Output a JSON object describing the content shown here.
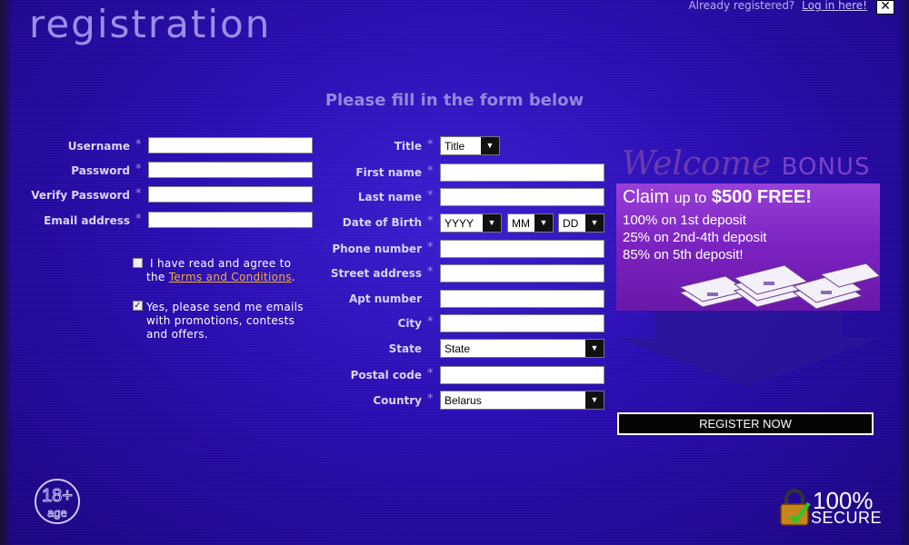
{
  "header": {
    "title": "registration",
    "already_text": "Already registered?",
    "login_link": "Log in here!",
    "close_label": "✕"
  },
  "subtitle": "Please fill in the form below",
  "left_form": {
    "username_label": "Username",
    "password_label": "Password",
    "verify_label": "Verify Password",
    "email_label": "Email address",
    "required_mark": "*"
  },
  "checkboxes": {
    "terms_text_1": "I have read and agree to",
    "terms_text_2": "the",
    "terms_link": "Terms and Conditions",
    "terms_dot": ".",
    "terms_checked": false,
    "promo_text": "Yes, please send me emails with promotions, contests and offers.",
    "promo_checked": true
  },
  "right_form": {
    "title_label": "Title",
    "title_value": "Title",
    "first_name_label": "First name",
    "last_name_label": "Last name",
    "dob_label": "Date of Birth",
    "dob_year": "YYYY",
    "dob_month": "MM",
    "dob_day": "DD",
    "phone_label": "Phone number",
    "street_label": "Street address",
    "apt_label": "Apt number",
    "city_label": "City",
    "state_label": "State",
    "state_value": "State",
    "postal_label": "Postal code",
    "country_label": "Country",
    "country_value": "Belarus"
  },
  "promo": {
    "welcome": "Welcome",
    "bonus": "BONUS",
    "claim_1": "Claim",
    "claim_2": "up to",
    "claim_3": "$500 FREE!",
    "line_1": "100% on 1st deposit",
    "line_2": "25% on 2nd-4th deposit",
    "line_3": "85% on 5th deposit!"
  },
  "register_button": "REGISTER NOW",
  "badges": {
    "age_number": "18+",
    "age_text": "age",
    "secure_pct": "100%",
    "secure_text": "SECURE"
  },
  "colors": {
    "background": "#2a0fa8",
    "accent_link": "#f0b030",
    "label": "#d8d4f4",
    "promo_purple": "#8a30c8"
  }
}
